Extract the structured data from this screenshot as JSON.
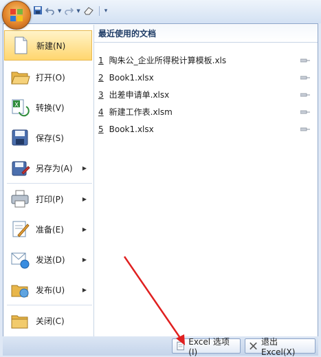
{
  "qat": {
    "office_button_icon": "office-logo-icon",
    "tools": [
      "save-icon",
      "undo-icon",
      "redo-icon",
      "eraser-icon",
      "customize-qat-icon"
    ]
  },
  "menu": {
    "items": [
      {
        "label": "新建(N)",
        "icon": "new-document-icon",
        "has_submenu": false,
        "selected": true
      },
      {
        "label": "打开(O)",
        "icon": "open-folder-icon",
        "has_submenu": false
      },
      {
        "label": "转换(V)",
        "icon": "convert-icon",
        "has_submenu": false
      },
      {
        "label": "保存(S)",
        "icon": "save-disk-icon",
        "has_submenu": false
      },
      {
        "label": "另存为(A)",
        "icon": "save-as-icon",
        "has_submenu": true
      },
      {
        "label": "打印(P)",
        "icon": "printer-icon",
        "has_submenu": true
      },
      {
        "label": "准备(E)",
        "icon": "prepare-icon",
        "has_submenu": true
      },
      {
        "label": "发送(D)",
        "icon": "send-icon",
        "has_submenu": true
      },
      {
        "label": "发布(U)",
        "icon": "publish-icon",
        "has_submenu": true
      },
      {
        "label": "关闭(C)",
        "icon": "close-folder-icon",
        "has_submenu": false
      }
    ],
    "recent_title": "最近使用的文档",
    "recent_files": [
      {
        "num": "1",
        "name": "陶朱公_企业所得税计算模板.xls"
      },
      {
        "num": "2",
        "name": "Book1.xlsx"
      },
      {
        "num": "3",
        "name": "出差申请单.xlsx"
      },
      {
        "num": "4",
        "name": "新建工作表.xlsm"
      },
      {
        "num": "5",
        "name": "Book1.xlsx"
      }
    ]
  },
  "bottom": {
    "options_label": "Excel 选项(I)",
    "exit_label": "退出 Excel(X)"
  },
  "colors": {
    "selected_bg": "#ffd66e",
    "annotation": "#e02020"
  }
}
